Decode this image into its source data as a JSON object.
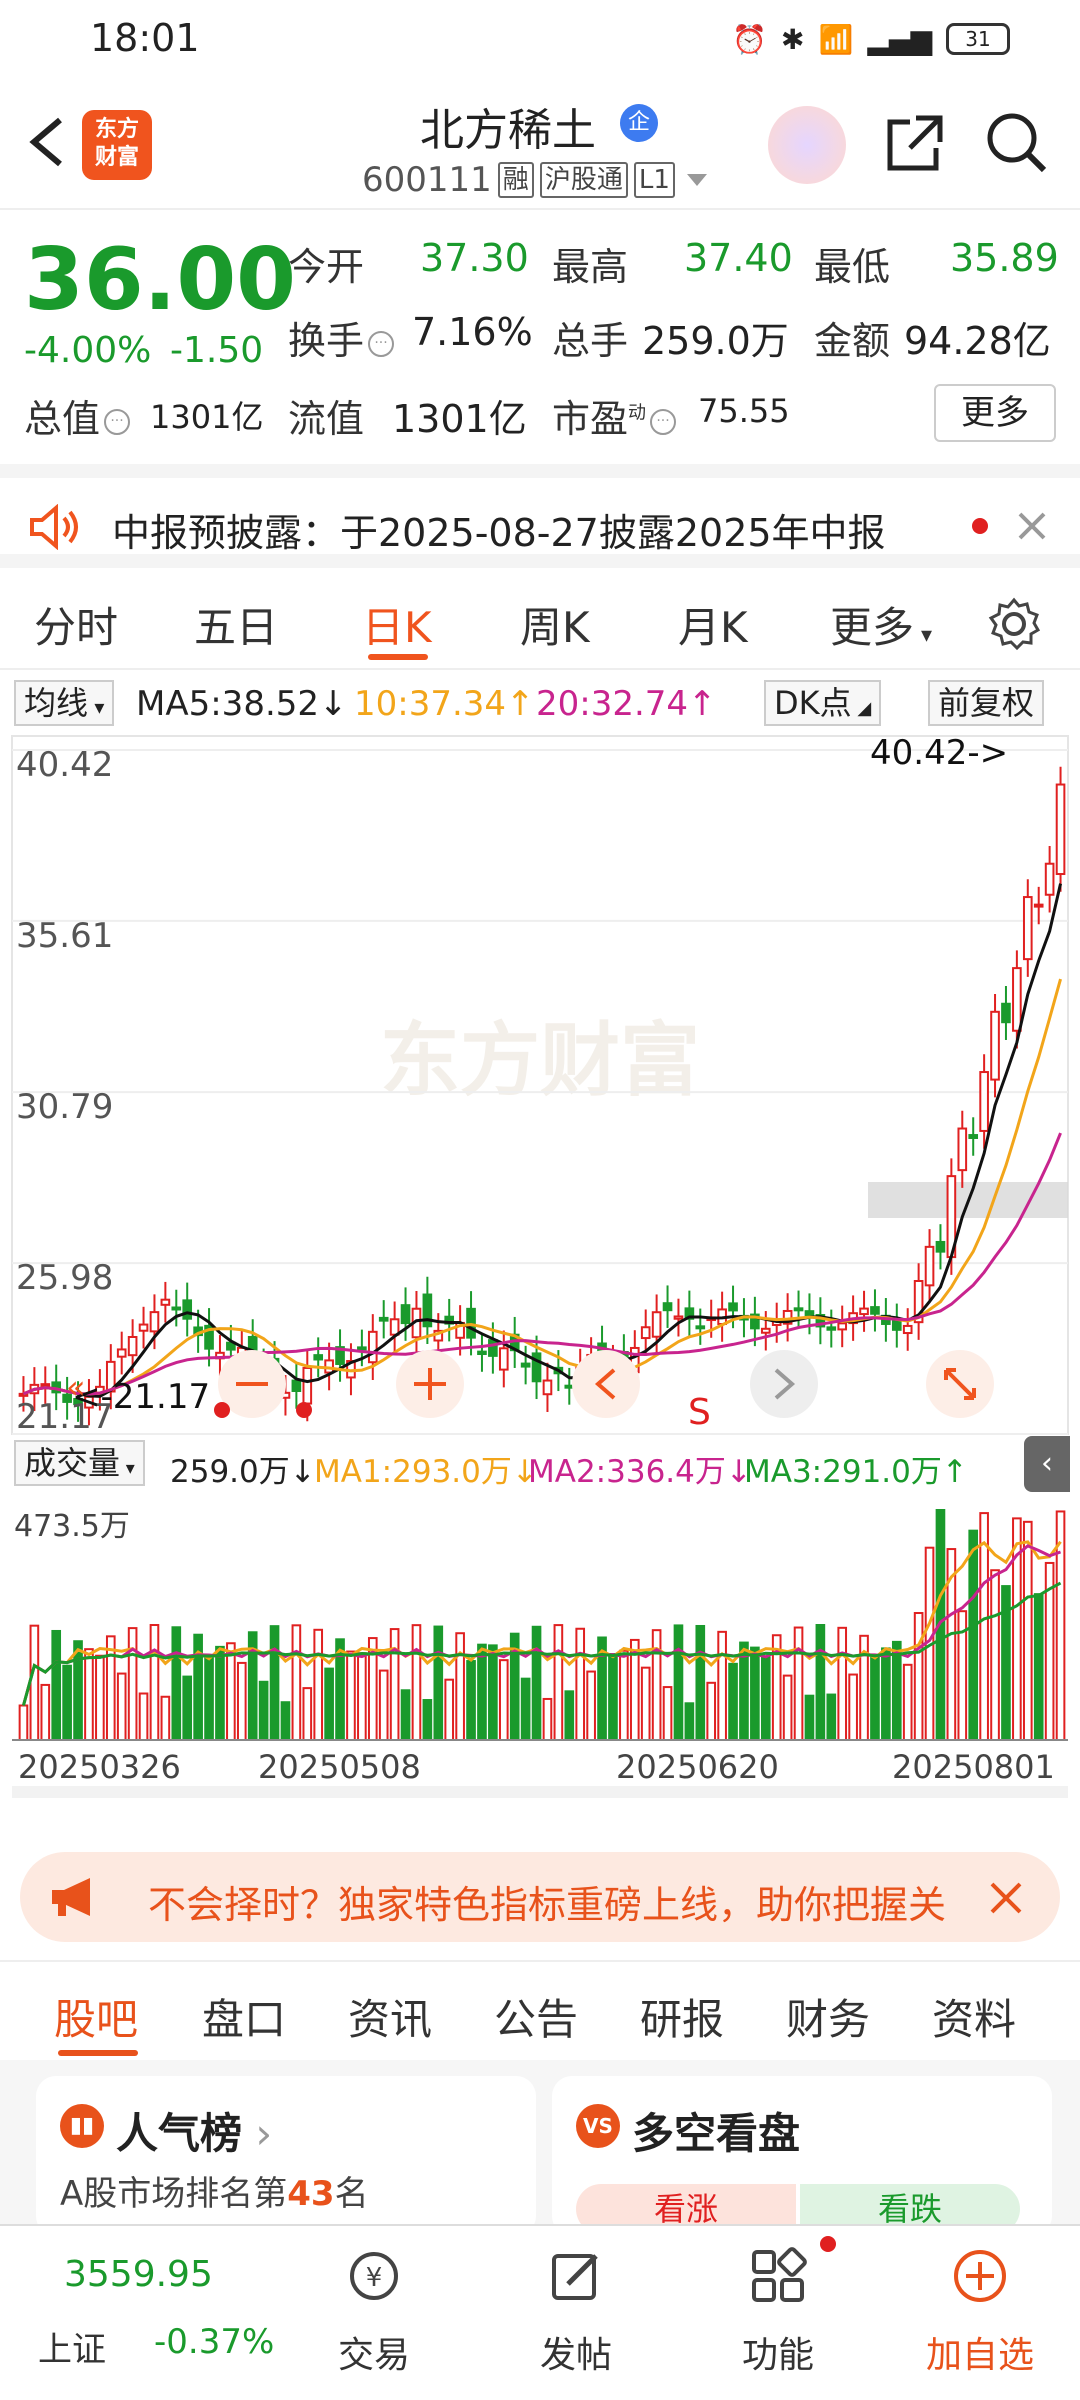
{
  "status": {
    "time": "18:01",
    "battery": "31"
  },
  "header": {
    "name": "北方稀土",
    "badge": "企",
    "code": "600111",
    "tags": [
      "融",
      "沪股通",
      "L1"
    ],
    "logo": "东方财富"
  },
  "quote": {
    "price": "36.00",
    "pct": "-4.00%",
    "change": "-1.50",
    "open_label": "今开",
    "open": "37.30",
    "high_label": "最高",
    "high": "37.40",
    "low_label": "最低",
    "low": "35.89",
    "turnover_label": "换手",
    "turnover": "7.16%",
    "volume_label": "总手",
    "volume": "259.0万",
    "amount_label": "金额",
    "amount": "94.28亿",
    "mcap_label": "总值",
    "mcap": "1301亿",
    "float_label": "流值",
    "float": "1301亿",
    "pe_label": "市盈",
    "pe_sup": "动",
    "pe": "75.55",
    "more": "更多"
  },
  "notice": {
    "text": "中报预披露：于2025-08-27披露2025年中报"
  },
  "ktabs": [
    "分时",
    "五日",
    "日K",
    "周K",
    "月K",
    "更多"
  ],
  "ma": {
    "btn": "均线",
    "ma5": "MA5:38.52↓",
    "ma10": "10:37.34↑",
    "ma20": "20:32.74↑",
    "dk": "DK点",
    "fq": "前复权"
  },
  "chart_data": {
    "type": "candlestick",
    "price_ticks": [
      "40.42",
      "35.61",
      "30.79",
      "25.98",
      "21.17"
    ],
    "max_label": "40.42->",
    "min_label": "<-21.17",
    "volume_ticks": [
      "473.5万"
    ],
    "dates": [
      "20250326",
      "20250508",
      "20250620",
      "20250801"
    ],
    "signal": "S",
    "volume_indicator": {
      "label": "成交量",
      "value": "259.0万↓",
      "ma1": "MA1:293.0万↓",
      "ma2": "MA2:336.4万↓",
      "ma3": "MA3:291.0万↑"
    }
  },
  "promo": {
    "text": "不会择时？独家特色指标重磅上线，助你把握关"
  },
  "btabs": [
    "股吧",
    "盘口",
    "资讯",
    "公告",
    "研报",
    "财务",
    "资料"
  ],
  "cards": {
    "left_title": "人气榜",
    "left_sub_prefix": "A股市场排名第",
    "left_rank": "43",
    "left_sub_suffix": "名",
    "right_title": "多空看盘",
    "right_up": "看涨",
    "right_down": "看跌"
  },
  "bottom_nav": {
    "index_value": "3559.95",
    "index_name": "上证",
    "index_change": "-0.37%",
    "trade": "交易",
    "post": "发帖",
    "func": "功能",
    "add": "加自选"
  },
  "colors": {
    "up": "#e02020",
    "down": "#1a9a2c",
    "accent": "#f0541e"
  }
}
